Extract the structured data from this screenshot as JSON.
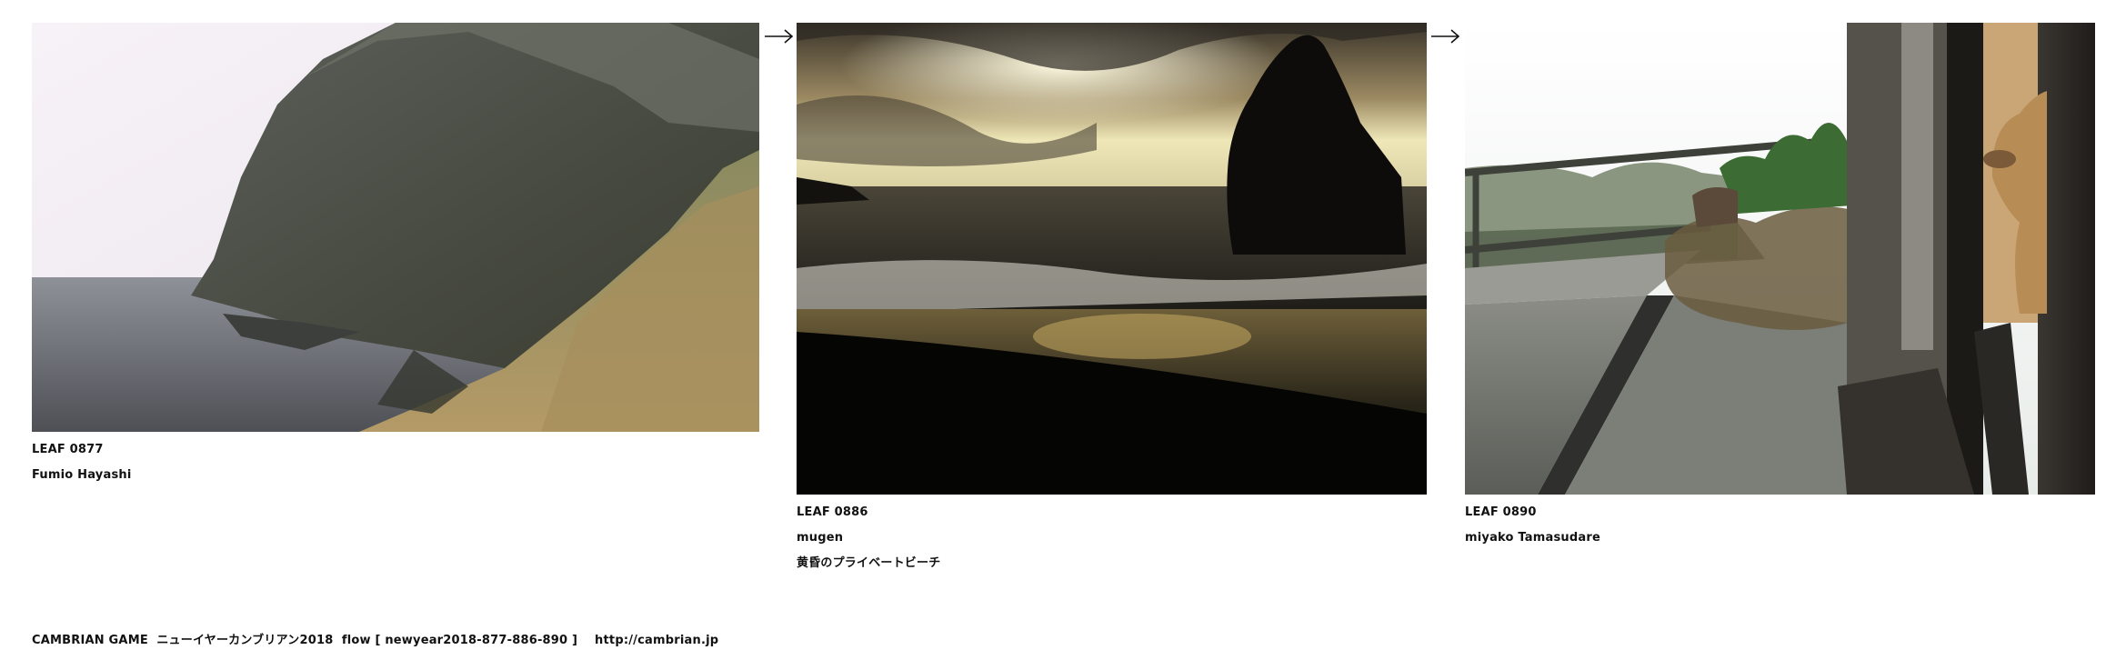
{
  "leaves": [
    {
      "id": "LEAF 0877",
      "author": "Fumio Hayashi",
      "subtitle": "",
      "image_desc": "sea-cliff-photo"
    },
    {
      "id": "LEAF 0886",
      "author": "mugen",
      "subtitle": "黄昏のプライベートビーチ",
      "image_desc": "sunset-beach-photo"
    },
    {
      "id": "LEAF 0890",
      "author": "miyako Tamasudare",
      "subtitle": "",
      "image_desc": "dog-porch-photo"
    }
  ],
  "arrow_icon": "right-arrow-icon",
  "footer": {
    "text": "CAMBRIAN GAME  ニューイヤーカンブリアン2018  flow [ newyear2018-877-886-890 ]    http://cambrian.jp"
  }
}
